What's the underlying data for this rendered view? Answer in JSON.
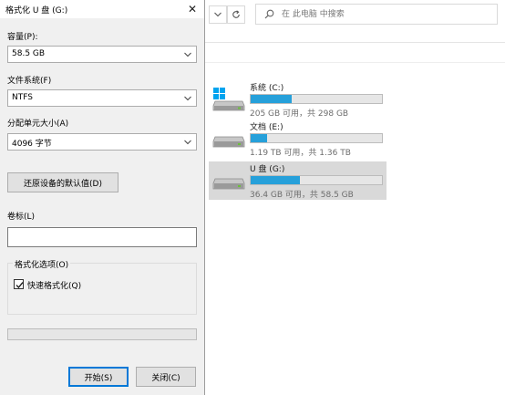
{
  "explorer": {
    "search": {
      "placeholder": "在 此电脑 中搜索"
    },
    "drives": [
      {
        "name": "系统 (C:)",
        "info": "205 GB 可用，共 298 GB",
        "used_fraction": 0.31,
        "icon": "windows-drive-icon",
        "selected": false
      },
      {
        "name": "文档 (E:)",
        "info": "1.19 TB 可用，共 1.36 TB",
        "used_fraction": 0.125,
        "icon": "drive-icon",
        "selected": false
      },
      {
        "name": "U 盘 (G:)",
        "info": "36.4 GB 可用，共 58.5 GB",
        "used_fraction": 0.378,
        "icon": "usb-drive-icon",
        "selected": true
      }
    ]
  },
  "dialog": {
    "title": "格式化 U 盘 (G:)",
    "capacity": {
      "label": "容量(P):",
      "value": "58.5 GB"
    },
    "filesystem": {
      "label": "文件系统(F)",
      "value": "NTFS"
    },
    "allocation": {
      "label": "分配单元大小(A)",
      "value": "4096 字节"
    },
    "restore_label": "还原设备的默认值(D)",
    "volume": {
      "label": "卷标(L)",
      "value": ""
    },
    "options": {
      "label": "格式化选项(O)",
      "quick_label": "快速格式化(Q)",
      "quick_checked": true
    },
    "progress": 0,
    "start_label": "开始(S)",
    "close_label": "关闭(C)"
  },
  "colors": {
    "accent": "#0078d7",
    "drive_bar": "#26a0da",
    "progress": "#06b025",
    "selected_row": "#d9d9d9"
  }
}
